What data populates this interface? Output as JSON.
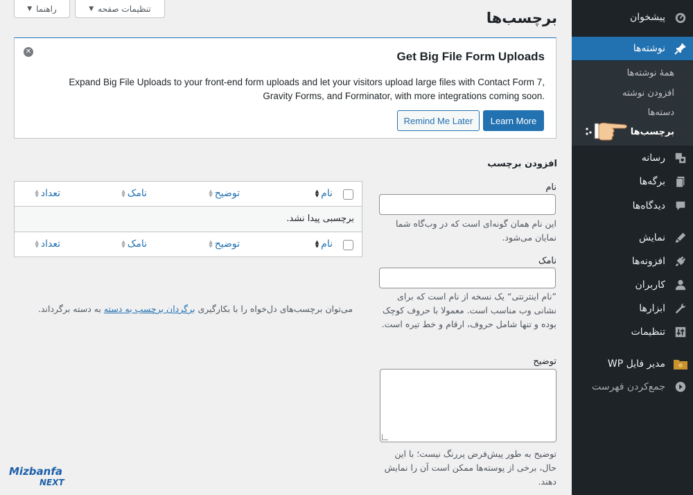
{
  "screen_meta": {
    "help_label": "راهنما",
    "options_label": "تنظیمات صفحه"
  },
  "page_title": "برچسب‌ها",
  "notice": {
    "title": "Get Big File Form Uploads",
    "body": "Expand Big File Uploads to your front-end form uploads and let your visitors upload large files with Contact Form 7, Gravity Forms, and Forminator, with more integrations coming soon.",
    "learn_more": "Learn More",
    "remind_later": "Remind Me Later"
  },
  "sidebar": {
    "items": [
      {
        "label": "پیشخوان",
        "icon": "dashboard-icon"
      },
      {
        "label": "نوشته‌ها",
        "icon": "pin-icon",
        "active": true
      },
      {
        "label": "رسانه",
        "icon": "media-icon"
      },
      {
        "label": "برگه‌ها",
        "icon": "pages-icon"
      },
      {
        "label": "دیدگاه‌ها",
        "icon": "comments-icon"
      },
      {
        "label": "نمایش",
        "icon": "appearance-icon"
      },
      {
        "label": "افزونه‌ها",
        "icon": "plugins-icon"
      },
      {
        "label": "کاربران",
        "icon": "users-icon"
      },
      {
        "label": "ابزارها",
        "icon": "tools-icon"
      },
      {
        "label": "تنظیمات",
        "icon": "settings-icon"
      },
      {
        "label": "WP مدیر فایل",
        "icon": "folder-icon"
      },
      {
        "label": "جمع‌کردن فهرست",
        "icon": "collapse-icon"
      }
    ],
    "submenu": [
      {
        "label": "همهٔ نوشته‌ها"
      },
      {
        "label": "افزودن نوشته"
      },
      {
        "label": "دسته‌ها"
      },
      {
        "label": "برچسب‌ها",
        "current": true
      }
    ]
  },
  "add_form": {
    "heading": "افزودن برچسب",
    "name_label": "نام",
    "name_help": "این نام همان گونه‌ای است که در وب‌گاه شما نمایان می‌شود.",
    "slug_label": "نامک",
    "slug_help": "”نام اینترنتی“ یک نسخه از نام است که برای نشانی وب مناسب است. معمولا با حروف کوچک بوده و تنها شامل حروف، ارقام و خط تیره است.",
    "desc_label": "توضیح",
    "desc_help": "توضیح به طور پیش‌فرض پررنگ نیست؛ با این حال، برخی از پوسته‌ها ممکن است آن را نمایش دهند."
  },
  "table": {
    "columns": [
      "نام",
      "توضیح",
      "نامک",
      "تعداد"
    ],
    "empty_message": "برچسبی پیدا نشد."
  },
  "conversion": {
    "before": "می‌توان برچسب‌های دل‌خواه را با بکارگیری ",
    "link": "برگردان برچسب به دسته",
    "after": " به دسته برگرداند."
  },
  "logo": {
    "top": "Mizbanfa",
    "bottom": "NEXT"
  }
}
